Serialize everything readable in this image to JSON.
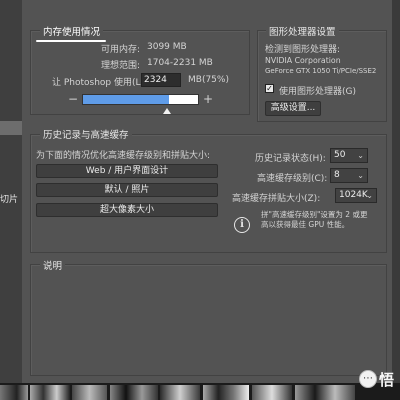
{
  "left_panel": {
    "cut_text": "切片"
  },
  "memory": {
    "legend": "内存使用情况",
    "available_label": "可用内存:",
    "available_value": "3099 MB",
    "ideal_label": "理想范围:",
    "ideal_value": "1704-2231 MB",
    "let_label": "让 Photoshop 使用(L):",
    "let_value": "2324",
    "let_unit": "MB(75%)",
    "minus": "−",
    "plus": "+",
    "usage_fraction": 0.75
  },
  "gpu": {
    "legend": "图形处理器设置",
    "detected_label": "检测到图形处理器:",
    "vendor": "NVIDIA Corporation",
    "model": "GeForce GTX 1050 Ti/PCIe/SSE2",
    "use_gpu_label": "使用图形处理器(G)",
    "use_gpu_checked": "✓",
    "advanced_button": "高级设置..."
  },
  "history_cache": {
    "legend": "历史记录与高速缓存",
    "optimize_text": "为下面的情况优化高速缓存级别和拼贴大小:",
    "preset_buttons": [
      "Web / 用户界面设计",
      "默认 / 照片",
      "超大像素大小"
    ],
    "history_states_label": "历史记录状态(H):",
    "history_states_value": "50",
    "cache_levels_label": "高速缓存级别(C):",
    "cache_levels_value": "8",
    "tile_size_label": "高速缓存拼贴大小(Z):",
    "tile_size_value": "1024K",
    "info_note_line1": "拼\"高速缓存级别\"设置为 2 或更",
    "info_note_line2": "高以获得最佳 GPU 性能。"
  },
  "description": {
    "legend": "说明"
  },
  "watermark": {
    "text": "悟"
  },
  "colors": {
    "accent": "#5f9ce8",
    "panel": "#535353"
  }
}
